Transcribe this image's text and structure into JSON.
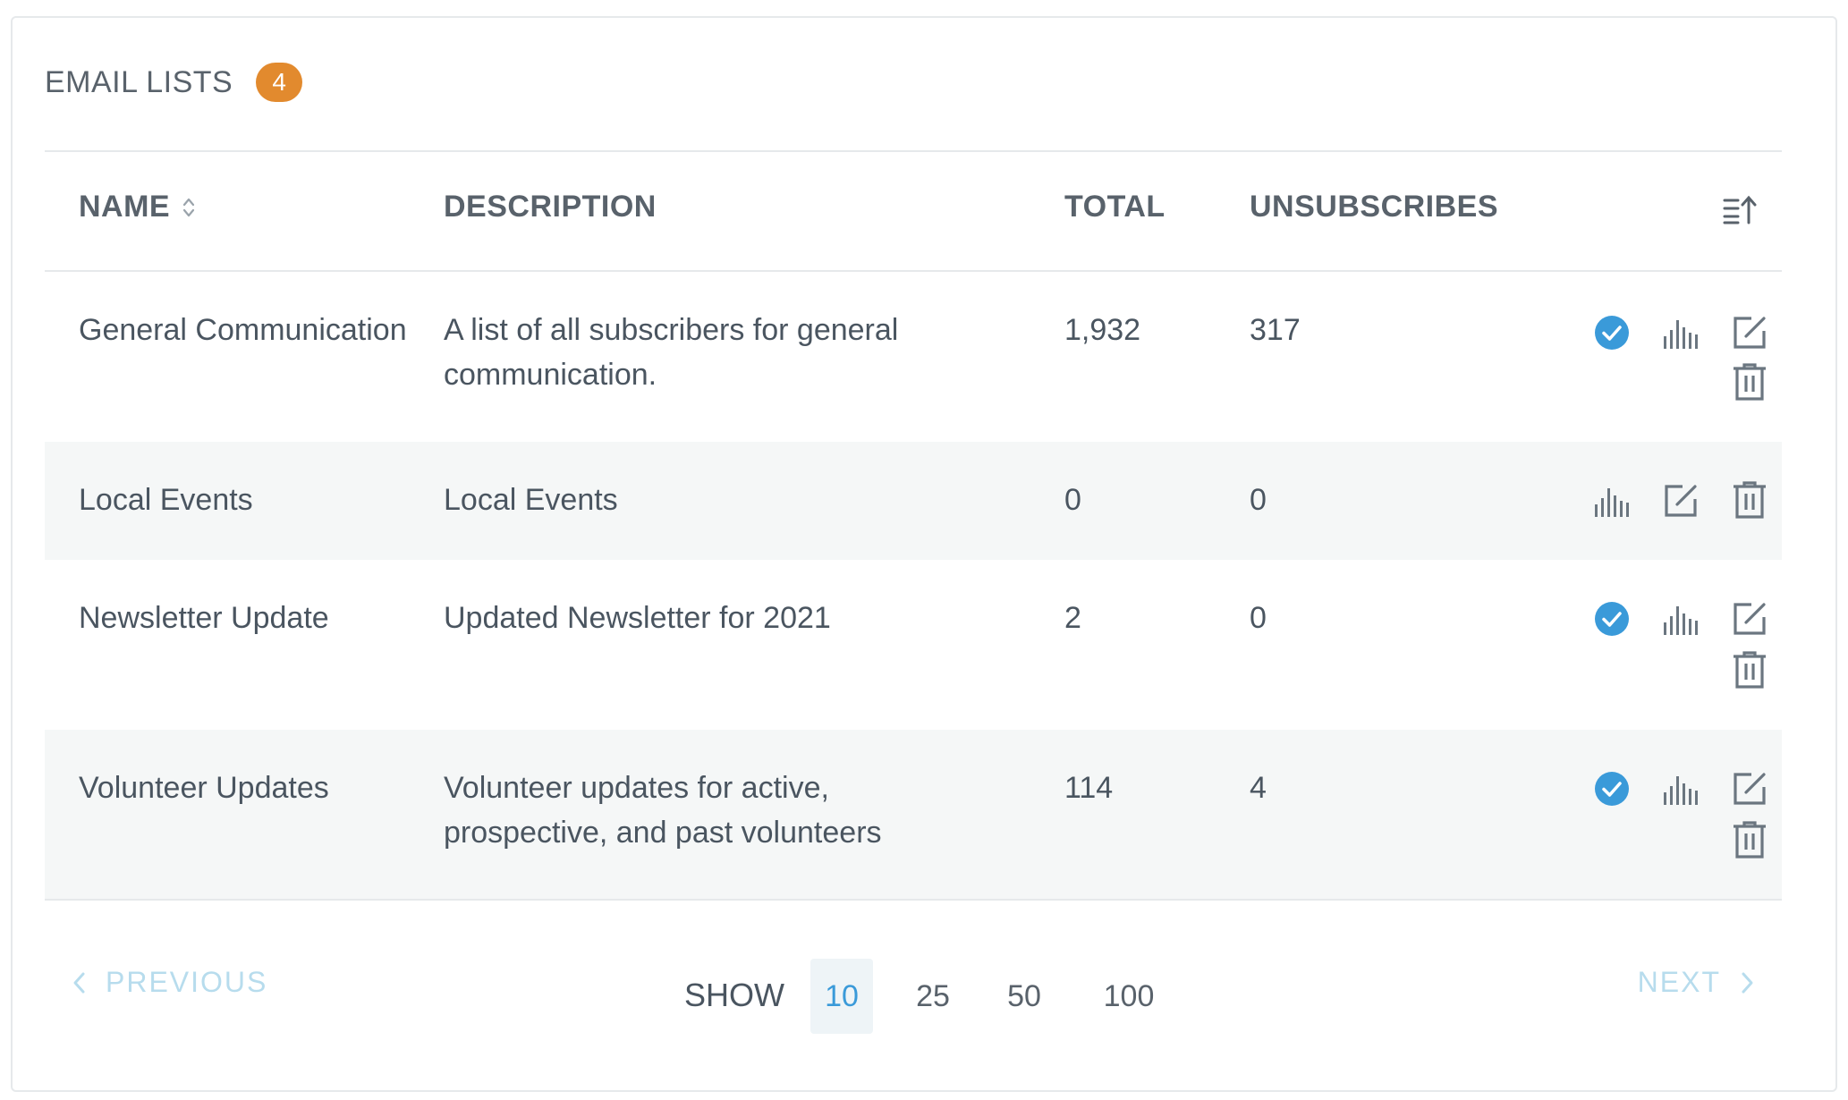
{
  "header": {
    "title": "EMAIL LISTS",
    "count": "4"
  },
  "columns": {
    "name": "NAME",
    "description": "DESCRIPTION",
    "total": "TOTAL",
    "unsubscribes": "UNSUBSCRIBES"
  },
  "rows": [
    {
      "name": "General Communication",
      "description": "A list of all subscribers for general communication.",
      "total": "1,932",
      "unsubscribes": "317",
      "verified": true
    },
    {
      "name": "Local Events",
      "description": "Local Events",
      "total": "0",
      "unsubscribes": "0",
      "verified": false
    },
    {
      "name": "Newsletter Update",
      "description": "Updated Newsletter for 2021",
      "total": "2",
      "unsubscribes": "0",
      "verified": true
    },
    {
      "name": "Volunteer Updates",
      "description": "Volunteer updates for active, prospective, and past volunteers",
      "total": "114",
      "unsubscribes": "4",
      "verified": true
    }
  ],
  "pagination": {
    "previous_label": "PREVIOUS",
    "next_label": "NEXT",
    "show_label": "SHOW",
    "page_sizes": [
      "10",
      "25",
      "50",
      "100"
    ],
    "selected_page_size": "10"
  },
  "icons": {
    "sort": "sort-icon",
    "column_settings": "column-settings-icon",
    "verified": "check-circle-icon",
    "stats": "bar-chart-icon",
    "edit": "edit-icon",
    "delete": "trash-icon",
    "prev": "chevron-left-icon",
    "next": "chevron-right-icon"
  },
  "colors": {
    "badge": "#e28a2e",
    "verified": "#3a9ad9",
    "link_disabled": "#b7dced",
    "row_alt": "#f5f7f7",
    "text": "#4a5560"
  }
}
